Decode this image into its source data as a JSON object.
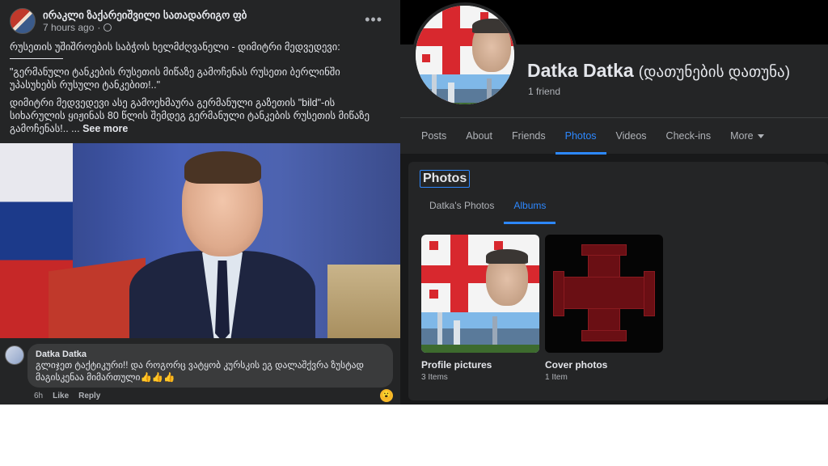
{
  "post": {
    "author": "ირაკლი ზაქარეიშვილი სათადარიგო ფბ",
    "time": "7 hours ago",
    "more_icon": "more-horizontal-icon",
    "line1": "რუსეთის უშიშროების საბჭოს ხელმძღვანელი - დიმიტრი მედვედევი:",
    "quote": "\"გერმანული ტანკების რუსეთის მიწაზე გამოჩენას რუსეთი ბერლინში უპასუხებს რუსული ტანკებით!..\"",
    "body": "დიმიტრი მედვედევი ასე გამოეხმაურა გერმანული გაზეთის \"bild\"-ის სიხარულის ყიჟინას 80 წლის შემდეგ გერმანული ტანკების რუსეთის მიწაზე გამოჩენას!.. ...",
    "see_more": "See more"
  },
  "comment": {
    "author": "Datka Datka",
    "text": "გლიჯეთ ტაქტიკური!! და როგორც ვატყობ კურსკის ეგ დალაშქვრა ზუსტად მაგისკენაა მიმართული👍👍👍",
    "time": "6h",
    "like": "Like",
    "reply": "Reply",
    "reaction": "😮"
  },
  "profile": {
    "name": "Datka Datka",
    "alt_name": "(დათუნების დათუნა)",
    "friends": "1 friend",
    "nav": [
      "Posts",
      "About",
      "Friends",
      "Photos",
      "Videos",
      "Check-ins",
      "More"
    ],
    "active_nav": "Photos"
  },
  "photos": {
    "title": "Photos",
    "tabs": [
      "Datka's Photos",
      "Albums"
    ],
    "active_tab": "Albums",
    "albums": [
      {
        "name": "Profile pictures",
        "count": "3 Items"
      },
      {
        "name": "Cover photos",
        "count": "1 Item"
      }
    ]
  },
  "colors": {
    "accent": "#2d88ff",
    "dark_bg": "#18191a",
    "card_bg": "#242526"
  }
}
